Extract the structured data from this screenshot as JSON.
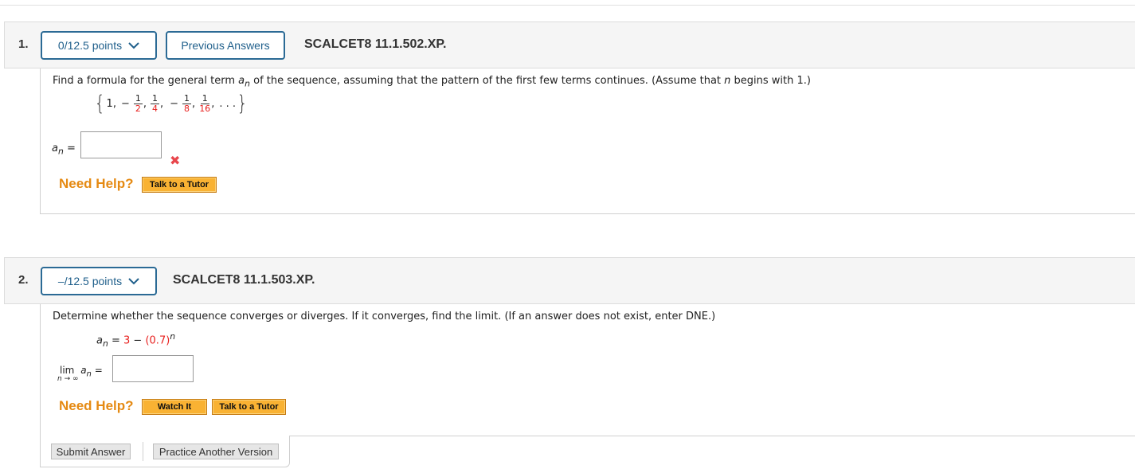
{
  "questions": [
    {
      "number": "1.",
      "points_label": "0/12.5 points",
      "previous_answers_label": "Previous Answers",
      "code": "SCALCET8 11.1.502.XP.",
      "prompt_parts": {
        "before": "Find a formula for the general term ",
        "var": "a",
        "var_sub": "n",
        "middle": " of the sequence, assuming that the pattern of the first few terms continues. (Assume that ",
        "n": "n",
        "after": " begins with 1.)"
      },
      "sequence": {
        "first": "1,",
        "terms": [
          {
            "sign": "−",
            "num": "1",
            "den": "2"
          },
          {
            "sign": "",
            "num": "1",
            "den": "4"
          },
          {
            "sign": "−",
            "num": "1",
            "den": "8"
          },
          {
            "sign": "",
            "num": "1",
            "den": "16"
          }
        ],
        "ellipsis": ". . ."
      },
      "answer_label": "a",
      "answer_sub": "n",
      "equals": "=",
      "answer_value": "",
      "status_icon": "incorrect-x-icon",
      "status_glyph": "✖",
      "need_help": "Need Help?",
      "help_buttons": [
        "Talk to a Tutor"
      ]
    },
    {
      "number": "2.",
      "points_label": "–/12.5 points",
      "code": "SCALCET8 11.1.503.XP.",
      "prompt": "Determine whether the sequence converges or diverges. If it converges, find the limit. (If an answer does not exist, enter DNE.)",
      "formula": {
        "lhs": "a",
        "lhs_sub": "n",
        "eq": " = ",
        "const": "3",
        "minus": " − ",
        "base": "(0.7)",
        "exp": "n"
      },
      "limit_label": "lim",
      "limit_sub": "n → ∞",
      "limit_var": "a",
      "limit_var_sub": "n",
      "equals": "=",
      "answer_value": "",
      "need_help": "Need Help?",
      "help_buttons": [
        "Watch It",
        "Talk to a Tutor"
      ],
      "submit_label": "Submit Answer",
      "practice_label": "Practice Another Version"
    }
  ],
  "colors": {
    "accent_blue": "#2b6a95",
    "need_help_orange": "#e58a13",
    "help_button": "#f9b233",
    "error_red": "#e8464c",
    "highlight_red": "#e8201e"
  }
}
